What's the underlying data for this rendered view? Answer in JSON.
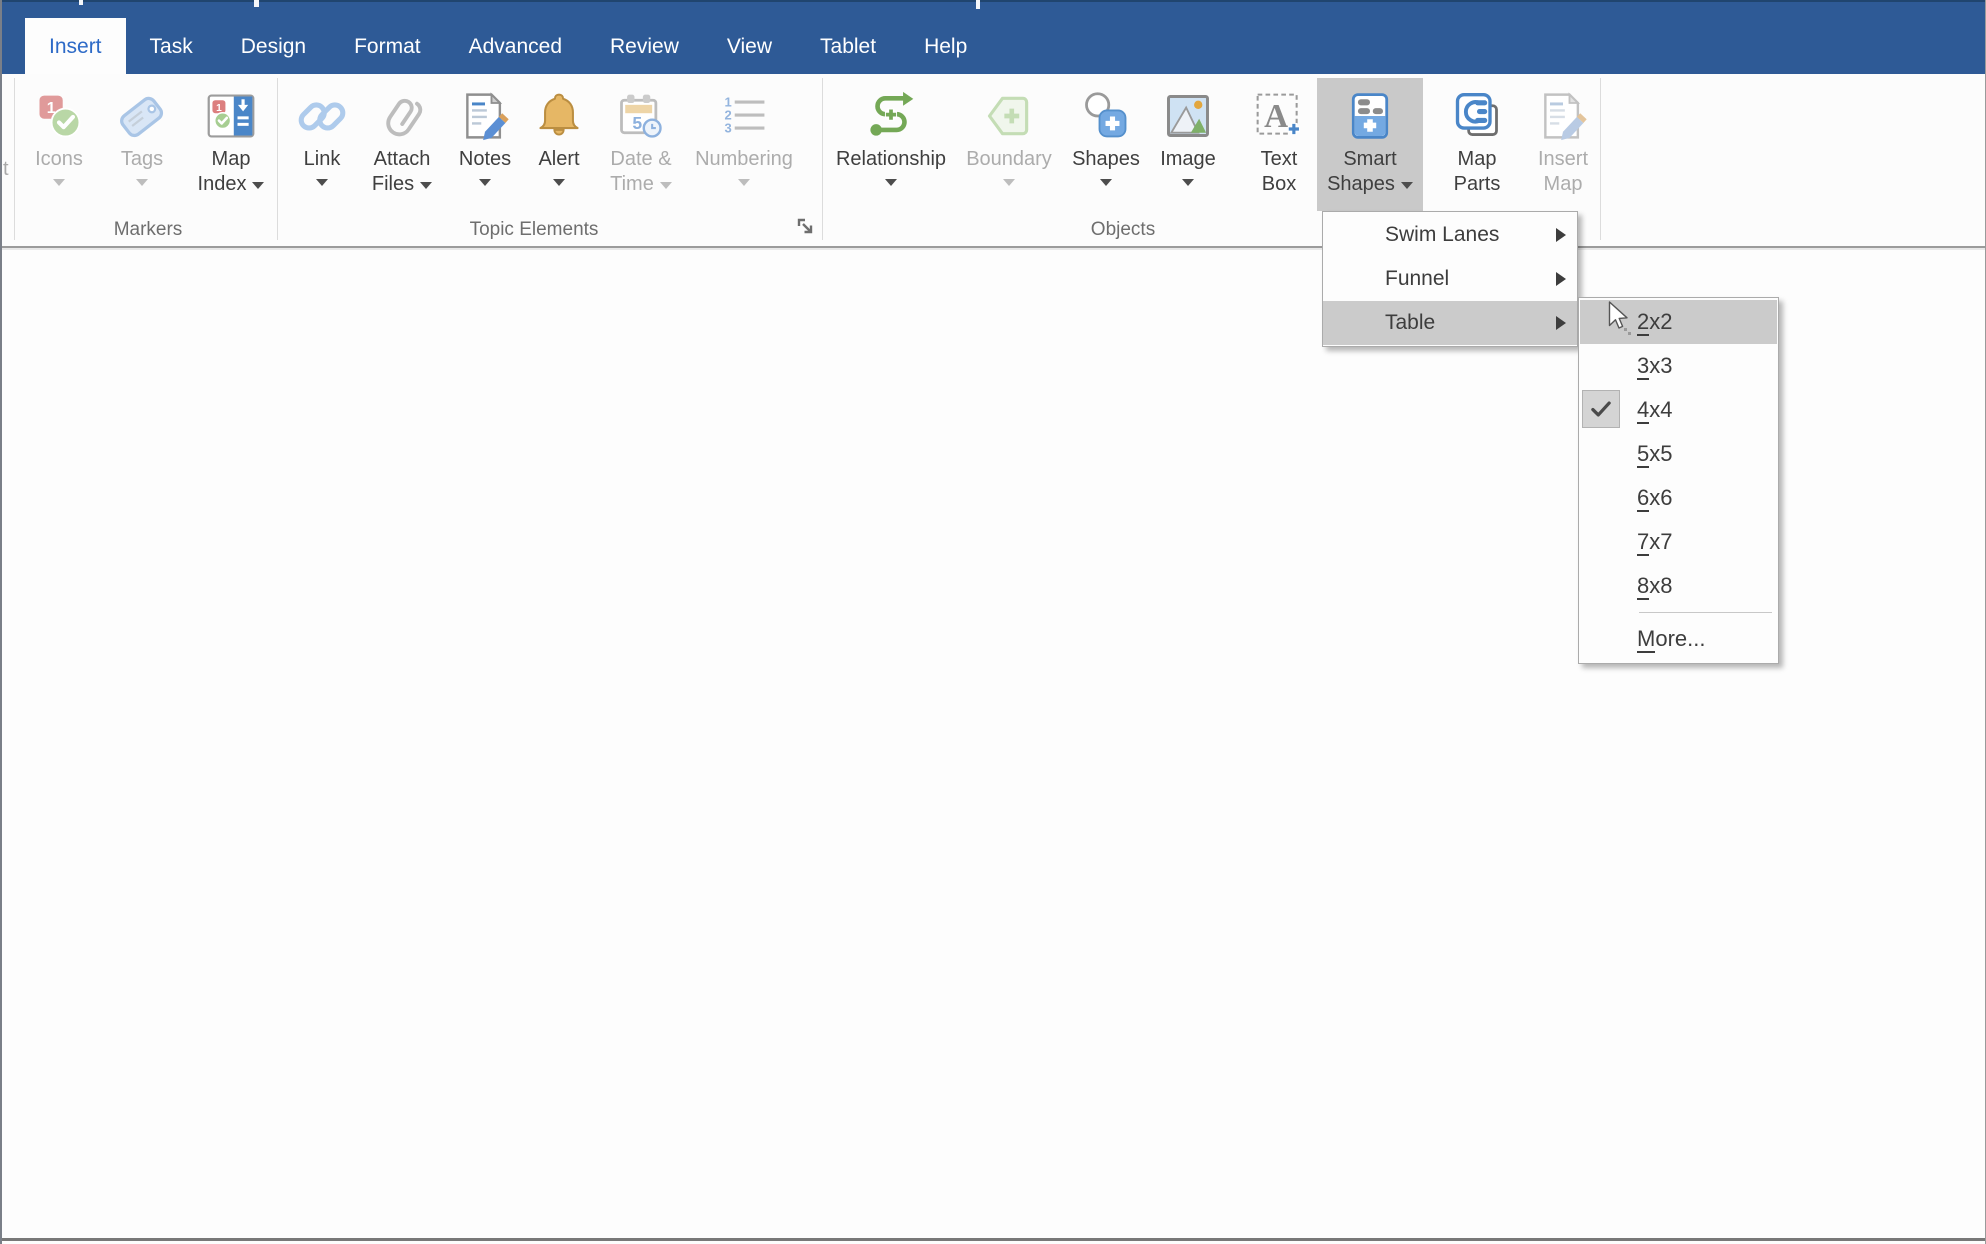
{
  "colors": {
    "menubar-bg": "#2e5a96",
    "active-tab-text": "#2d6ac7",
    "pressed-button-bg": "#c9c9c9",
    "menu-highlight-bg": "#cbcbcb",
    "icon-blue": "#4a86c8",
    "icon-green": "#74a856",
    "icon-gold": "#e6b765",
    "icon-red": "#dd8181"
  },
  "menubar": {
    "tabs": [
      "Insert",
      "Task",
      "Design",
      "Format",
      "Advanced",
      "Review",
      "View",
      "Tablet",
      "Help"
    ]
  },
  "ribbon": {
    "cropped_left_label": "t",
    "groups": [
      {
        "label": "Markers",
        "buttons": [
          {
            "label": "Icons",
            "disabled": true,
            "dropdown": true
          },
          {
            "label": "Tags",
            "disabled": true,
            "dropdown": true
          },
          {
            "label": "Map Index",
            "disabled": false,
            "dropdown": true
          }
        ]
      },
      {
        "label": "Topic Elements",
        "has_dialog_launcher": true,
        "buttons": [
          {
            "label": "Link",
            "disabled": false,
            "dropdown": true
          },
          {
            "label": "Attach Files",
            "disabled": false,
            "dropdown": true
          },
          {
            "label": "Notes",
            "disabled": false,
            "dropdown": true
          },
          {
            "label": "Alert",
            "disabled": false,
            "dropdown": true
          },
          {
            "label": "Date & Time",
            "disabled": true,
            "dropdown": true
          },
          {
            "label": "Numbering",
            "disabled": true,
            "dropdown": true
          }
        ]
      },
      {
        "label": "Objects",
        "buttons": [
          {
            "label": "Relationship",
            "disabled": false,
            "dropdown": true
          },
          {
            "label": "Boundary",
            "disabled": true,
            "dropdown": true
          },
          {
            "label": "Shapes",
            "disabled": false,
            "dropdown": true
          },
          {
            "label": "Image",
            "disabled": false,
            "dropdown": true
          },
          {
            "label": "Text Box",
            "disabled": false,
            "dropdown": false
          },
          {
            "label": "Smart Shapes",
            "disabled": false,
            "dropdown": true,
            "pressed": true
          },
          {
            "label": "Map Parts",
            "disabled": false,
            "dropdown": false
          },
          {
            "label": "Insert Map",
            "disabled": true,
            "dropdown": false
          }
        ]
      }
    ]
  },
  "menus": {
    "smart_shapes": {
      "items": [
        {
          "label": "Swim Lanes",
          "has_submenu": true,
          "highlighted": false
        },
        {
          "label": "Funnel",
          "has_submenu": true,
          "highlighted": false
        },
        {
          "label": "Table",
          "has_submenu": true,
          "highlighted": true
        }
      ]
    },
    "table_submenu": {
      "items": [
        {
          "key": "2",
          "rest": "x2",
          "highlighted": true
        },
        {
          "key": "3",
          "rest": "x3"
        },
        {
          "key": "4",
          "rest": "x4",
          "checked": true
        },
        {
          "key": "5",
          "rest": "x5"
        },
        {
          "key": "6",
          "rest": "x6"
        },
        {
          "key": "7",
          "rest": "x7"
        },
        {
          "key": "8",
          "rest": "x8"
        },
        {
          "key": "M",
          "rest": "ore...",
          "separator_before": true
        }
      ]
    }
  }
}
